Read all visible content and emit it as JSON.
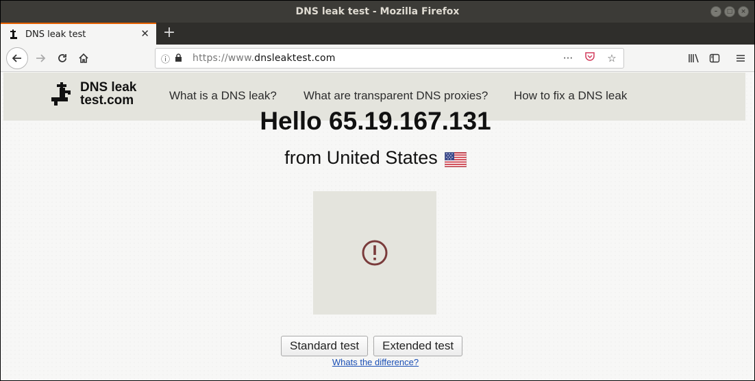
{
  "window": {
    "title": "DNS leak test - Mozilla Firefox"
  },
  "tabs": [
    {
      "label": "DNS leak test",
      "active": true
    }
  ],
  "navbar": {
    "url_scheme": "https://www.",
    "url_host": "dnsleaktest.com"
  },
  "site": {
    "logo_line1": "DNS leak",
    "logo_line2": "test.com",
    "nav": [
      "What is a DNS leak?",
      "What are transparent DNS proxies?",
      "How to fix a DNS leak"
    ]
  },
  "main": {
    "hello": "Hello 65.19.167.131",
    "from": "from United States",
    "flag_icon": "us-flag-icon",
    "status_icon": "exclamation-circle-icon",
    "buttons": [
      "Standard test",
      "Extended test"
    ],
    "difference_link": "Whats the difference?"
  },
  "colors": {
    "accent_tab": "#e66000",
    "header_bg": "#e4e4dd",
    "link": "#1a4fb5"
  }
}
